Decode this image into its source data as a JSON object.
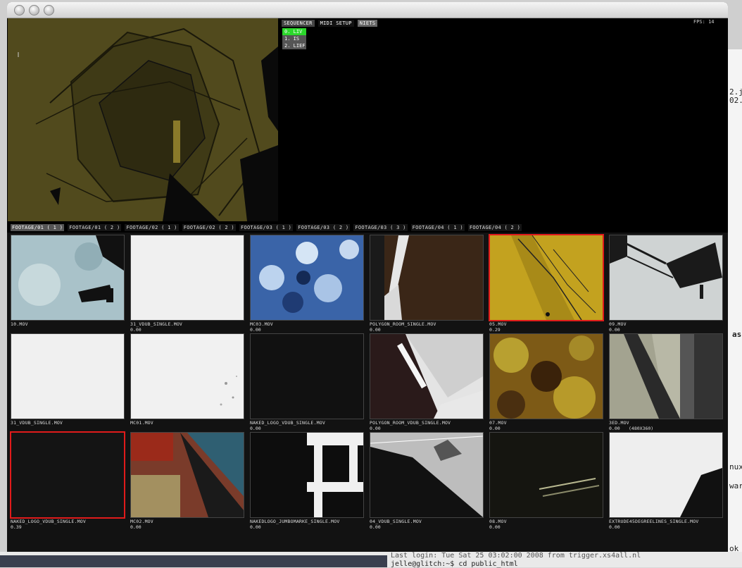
{
  "desktop": {
    "terminal_lines": [
      "2.j",
      "02.",
      "as",
      "nux",
      "war",
      "ok"
    ],
    "bottom_line_1": "Last login: Tue Sat 25 03:02:00 2008 from trigger.xs4all.nl",
    "bottom_line_2": "jelle@glitch:~$ cd public_html"
  },
  "header": {
    "tabs": [
      {
        "label": "SEQUENCER",
        "state": "active"
      },
      {
        "label": "MIDI SETUP",
        "state": "normal"
      },
      {
        "label": "NIETS",
        "state": "selected"
      }
    ],
    "fps": "FPS: 14"
  },
  "sequencer": {
    "items": [
      "0. LIV",
      "1. IS",
      "2. LIEF"
    ]
  },
  "footage": {
    "tabs": [
      "FOOTAGE/01 ( 1 )",
      "FOOTAGE/01 ( 2 )",
      "FOOTAGE/02 ( 1 )",
      "FOOTAGE/02 ( 2 )",
      "FOOTAGE/03 ( 1 )",
      "FOOTAGE/03 ( 2 )",
      "FOOTAGE/03 ( 3 )",
      "FOOTAGE/04 ( 1 )",
      "FOOTAGE/04 ( 2 )"
    ],
    "clips": [
      {
        "name": "10.MOV",
        "time": ""
      },
      {
        "name": "31_VDUB_SINGLE.MOV",
        "time": "0.00"
      },
      {
        "name": "MC03.MOV",
        "time": "0.00"
      },
      {
        "name": "POLYGON_ROOM_SINGLE.MOV",
        "time": "0.00"
      },
      {
        "name": "05.MOV",
        "time": "0.29"
      },
      {
        "name": "09.MOV",
        "time": "0.00"
      },
      {
        "name": "31_VDUB_SINGLE.MOV",
        "time": ""
      },
      {
        "name": "MC01.MOV",
        "time": ""
      },
      {
        "name": "NAKED_LOGO_VDUB_SINGLE.MOV",
        "time": "0.00"
      },
      {
        "name": "POLYGON_ROOM_VDUB_SINGLE.MOV",
        "time": "0.00"
      },
      {
        "name": "07.MOV",
        "time": "0.00"
      },
      {
        "name": "3ED.MOV",
        "time": "0.00",
        "res": "(480X360)"
      },
      {
        "name": "NAKED_LOGO_VDUB_SINGLE.MOV",
        "time": "0.39"
      },
      {
        "name": "MC02.MOV",
        "time": "0.00"
      },
      {
        "name": "NAKEDLOGO_JUMBOMARKE_SINGLE.MOV",
        "time": "0.00"
      },
      {
        "name": "04_VDUB_SINGLE.MOV",
        "time": "0.00"
      },
      {
        "name": "08.MOV",
        "time": "0.00"
      },
      {
        "name": "EXTRUDE45DEGREELINES_SINGLE.MOV",
        "time": "0.00"
      }
    ]
  }
}
